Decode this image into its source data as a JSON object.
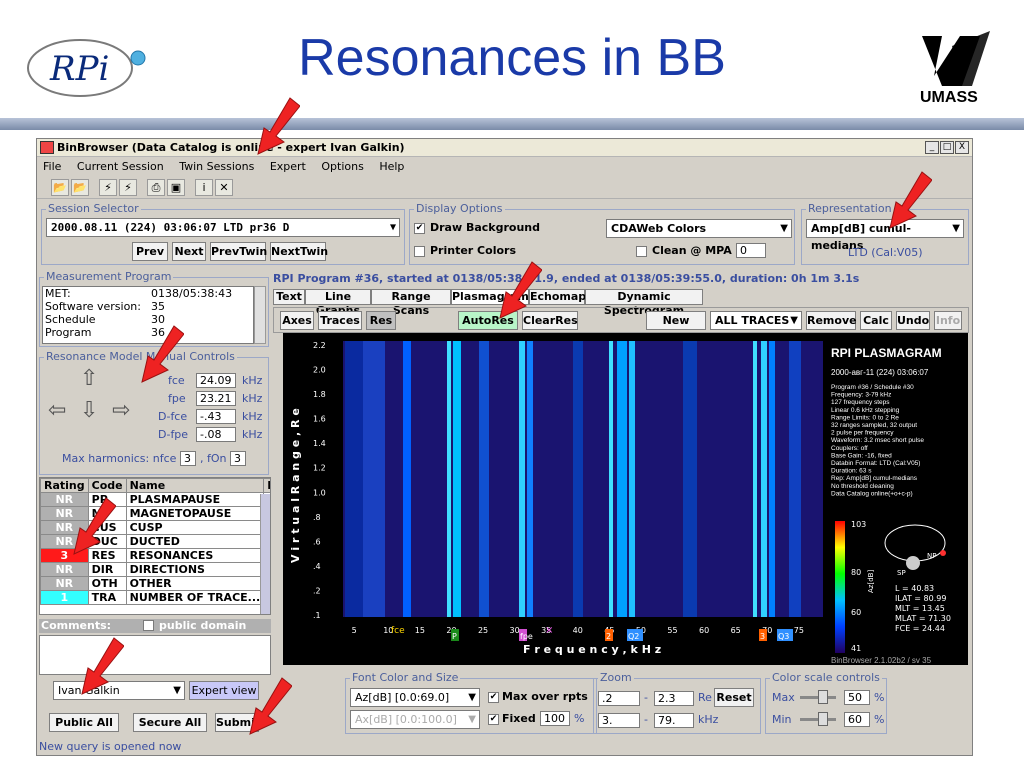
{
  "slide": {
    "title": "Resonances in BB",
    "rpi_logo_text": "RPi",
    "umass_logo_text": "UMASS"
  },
  "window": {
    "title": "BinBrowser (Data Catalog is online - expert Ivan Galkin)",
    "controls": [
      "_",
      "□",
      "X"
    ]
  },
  "menu": [
    "File",
    "Current Session",
    "Twin Sessions",
    "Expert",
    "Options",
    "Help"
  ],
  "toolbar_icons": [
    "open-folder-icon",
    "open-folder-plus-icon",
    "lightning-icon",
    "lightning-plus-icon",
    "print-icon",
    "image-icon",
    "info-icon",
    "tools-icon"
  ],
  "session": {
    "label": "Session Selector",
    "value": "2000.08.11 (224) 03:06:07 LTD pr36  D",
    "buttons": [
      "Prev",
      "Next",
      "PrevTwin",
      "NextTwin"
    ]
  },
  "display": {
    "label": "Display Options",
    "draw_background": "Draw Background",
    "printer_colors": "Printer Colors",
    "color_scheme": "CDAWeb Colors",
    "clean_label": "Clean @ MPA +",
    "clean_value": "0"
  },
  "representation": {
    "label": "Representation",
    "value": "Amp[dB] cumul-medians",
    "sub": "LTD (Cal:V05)"
  },
  "measurement": {
    "label": "Measurement Program",
    "rows": [
      {
        "key": "MET:",
        "value": "0138/05:38:43"
      },
      {
        "key": "Software version:",
        "value": "35"
      },
      {
        "key": "Schedule",
        "value": "30"
      },
      {
        "key": "Program",
        "value": "36"
      }
    ]
  },
  "resonance": {
    "label": "Resonance Model Manual Controls",
    "params": [
      {
        "name": "fce",
        "value": "24.09",
        "unit": "kHz"
      },
      {
        "name": "fpe",
        "value": "23.21",
        "unit": "kHz"
      },
      {
        "name": "D-fce",
        "value": "-.43",
        "unit": "kHz"
      },
      {
        "name": "D-fpe",
        "value": "-.08",
        "unit": "kHz"
      }
    ],
    "max_harmonics_label": "Max harmonics: nfce",
    "nfce": "3",
    "fon_label": ", fOn",
    "fon": "3"
  },
  "rating_table": {
    "headers": [
      "Rating",
      "Code",
      "Name",
      "Pu"
    ],
    "rows": [
      {
        "rating": "NR",
        "code": "PP",
        "name": "PLASMAPAUSE",
        "checked": false,
        "color": "#b0b0b0"
      },
      {
        "rating": "NR",
        "code": "MP",
        "name": "MAGNETOPAUSE",
        "checked": false,
        "color": "#b0b0b0"
      },
      {
        "rating": "NR",
        "code": "CUS",
        "name": "CUSP",
        "checked": false,
        "color": "#b0b0b0"
      },
      {
        "rating": "NR",
        "code": "DUC",
        "name": "DUCTED",
        "checked": false,
        "color": "#b0b0b0"
      },
      {
        "rating": "3",
        "code": "RES",
        "name": "RESONANCES",
        "checked": true,
        "color": "#ff1a1a"
      },
      {
        "rating": "NR",
        "code": "DIR",
        "name": "DIRECTIONS",
        "checked": false,
        "color": "#b0b0b0"
      },
      {
        "rating": "NR",
        "code": "OTH",
        "name": "OTHER",
        "checked": false,
        "color": "#b0b0b0"
      },
      {
        "rating": "1",
        "code": "TRA",
        "name": "NUMBER OF TRACE...",
        "checked": true,
        "color": "#33ffff"
      }
    ]
  },
  "comments": {
    "label": "Comments:",
    "public_domain": "public domain"
  },
  "user": {
    "name": "Ivan Galkin",
    "expert_view": "Expert view"
  },
  "bottom_buttons": [
    "Public All",
    "Secure All",
    "Submit"
  ],
  "status": "New query is opened now",
  "program_info": "RPI Program #36, started at 0138/05:38:51.9, ended at 0138/05:39:55.0, duration: 0h 1m 3.1s",
  "tabs": [
    "Text",
    "Line Graphs",
    "Range Scans",
    "Plasmagram",
    "Echomap",
    "Dynamic Spectrogram"
  ],
  "plot_toolbar": [
    "Axes",
    "Traces",
    "Res",
    "AutoRes",
    "ClearRes",
    "New trace",
    "ALL TRACES",
    "Remove",
    "Calc",
    "Undo",
    "Info"
  ],
  "plasmagram": {
    "title": "RPI PLASMAGRAM",
    "date": "2000-авг-11 (224) 03:06:07",
    "info_lines": [
      "Program #36 / Schedule #30",
      "Frequency: 3-79 kHz",
      "127 frequency steps",
      "Linear 0.6 kHz stepping",
      "Range Limits: 0 to 2 Re",
      "32 ranges sampled, 32 output",
      "2 pulse per frequency",
      "Waveform: 3.2 msec short pulse",
      "Couplers: off",
      "Base Gain: -16, fixed",
      "Databin Format: LTD (Cal:V05)",
      "Duration: 63 s",
      "Rep: Amp[dB] cumul-medians",
      "No threshold cleaning",
      "Data Catalog online(+o+c-p)"
    ],
    "colorbar_max": "103",
    "colorbar_labels": [
      "80",
      "60",
      "41"
    ],
    "colorbar_unit": "Az[dB]",
    "orbit_np": "NP",
    "orbit_sp": "SP",
    "orbit_info": [
      "L = 40.83",
      "ILAT = 80.99",
      "MLT = 13.45",
      "MLAT = 71.30",
      "FCE = 24.44"
    ],
    "footer": "BinBrowser 2.1.02b2 / sv 35",
    "xlabel": "F r e q u e n c y ,  k H z",
    "ylabel": "V i r t u a l   R a n g e ,  R e",
    "xticks": [
      "5",
      "10",
      "15",
      "20",
      "25",
      "30",
      "35",
      "40",
      "45",
      "50",
      "55",
      "60",
      "65",
      "70",
      "75"
    ],
    "yticks": [
      "2.2",
      "2.0",
      "1.8",
      "1.6",
      "1.4",
      "1.2",
      "1.0",
      ".8",
      ".6",
      ".4",
      ".2",
      ".1"
    ],
    "markers": [
      "fce",
      "P",
      "fpe",
      "×",
      "2",
      "Q2",
      "3",
      "Q3"
    ]
  },
  "font_color": {
    "label": "Font Color and Size",
    "combo1": "Az[dB] [0.0:69.0]",
    "combo2": "Ax[dB] [0.0:100.0]",
    "max_over_rpts": "Max over rpts",
    "fixed": "Fixed",
    "fixed_value": "100",
    "percent": "%"
  },
  "zoom": {
    "label": "Zoom",
    "range_from": ".2",
    "range_to": "2.3",
    "range_unit": "Re",
    "freq_from": "3.",
    "freq_to": "79.",
    "freq_unit": "kHz",
    "reset": "Reset",
    "dash": "-"
  },
  "color_scale": {
    "label": "Color scale controls",
    "max_label": "Max",
    "max_value": "50",
    "min_label": "Min",
    "min_value": "60",
    "percent": "%"
  }
}
